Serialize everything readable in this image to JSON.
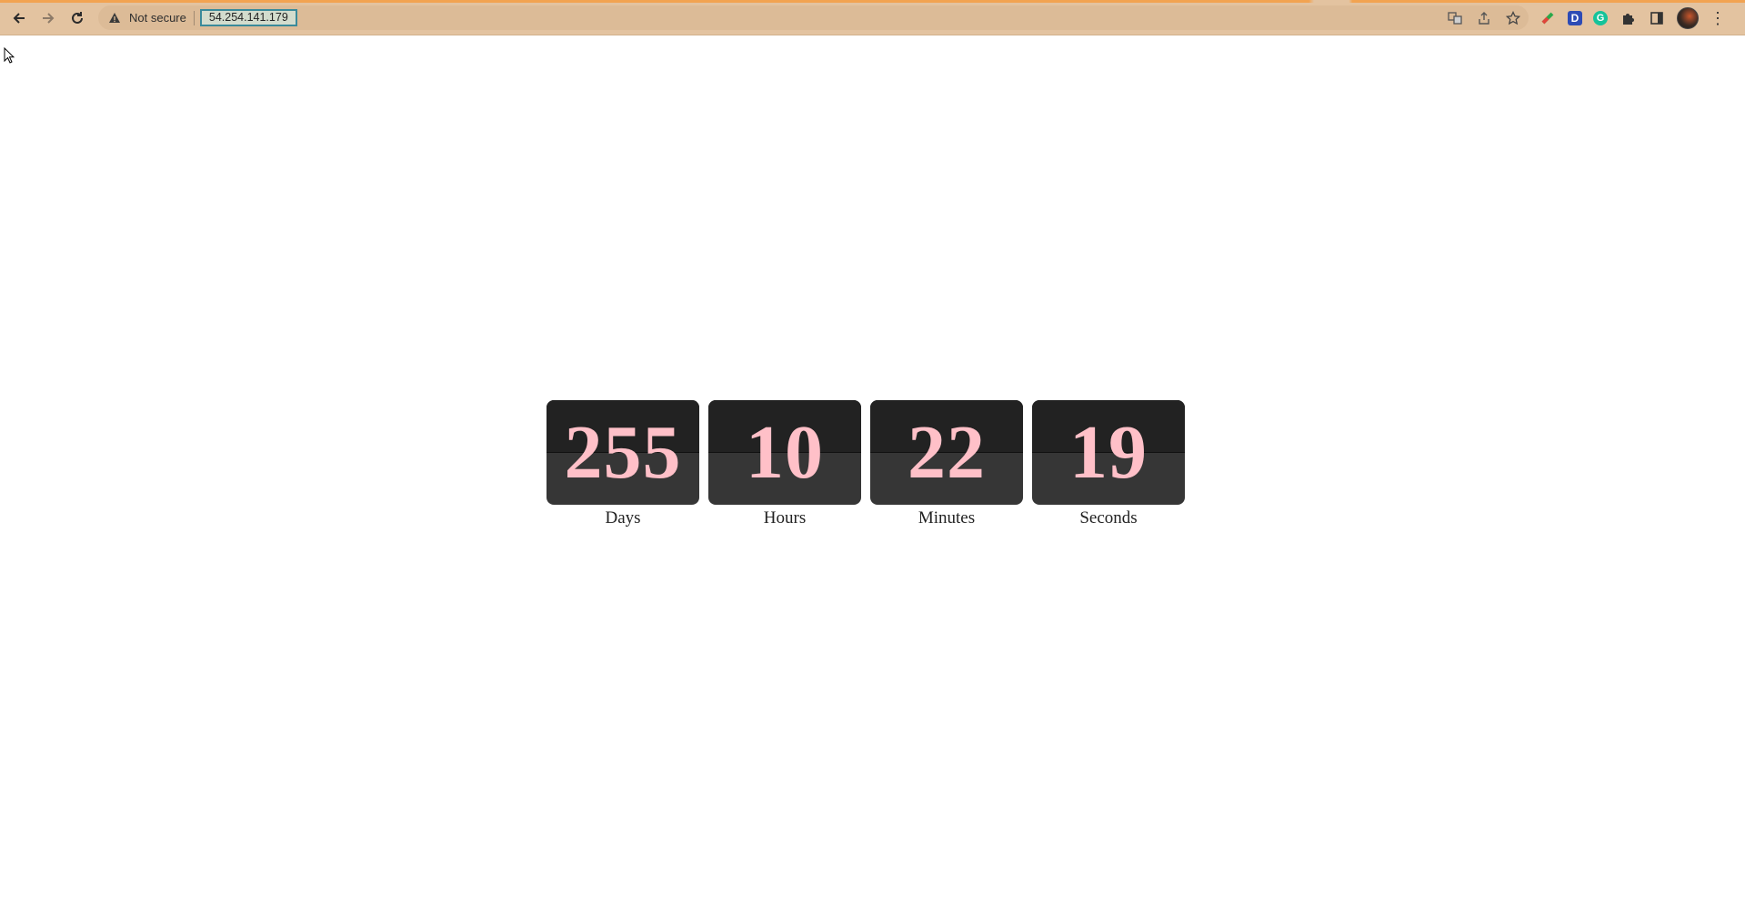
{
  "browser": {
    "security_label": "Not secure",
    "url": "54.254.141.179",
    "icons": [
      "back-icon",
      "forward-icon",
      "reload-icon",
      "warning-icon",
      "translate-icon",
      "share-icon",
      "bookmark-star-icon",
      "extension-vpn-icon",
      "extension-d-icon",
      "extension-grammarly-icon",
      "extensions-puzzle-icon",
      "side-panel-icon",
      "profile-avatar",
      "menu-icon"
    ]
  },
  "countdown": {
    "units": [
      {
        "value": "255",
        "label": "Days"
      },
      {
        "value": "10",
        "label": "Hours"
      },
      {
        "value": "22",
        "label": "Minutes"
      },
      {
        "value": "19",
        "label": "Seconds"
      }
    ]
  },
  "colors": {
    "chrome_bg": "#e3c3a0",
    "card_top": "#222222",
    "card_bottom": "#363636",
    "digit": "#ffc0c8"
  }
}
